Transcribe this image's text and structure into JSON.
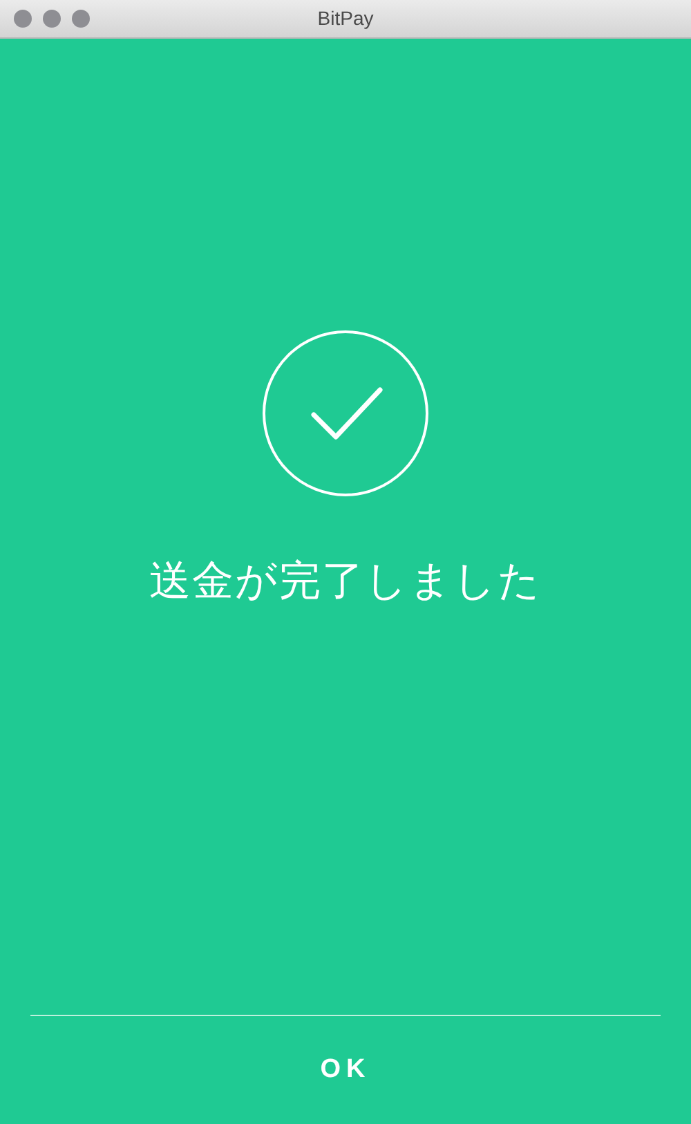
{
  "window": {
    "title": "BitPay"
  },
  "message": "送金が完了しました",
  "buttons": [
    "OK"
  ]
}
